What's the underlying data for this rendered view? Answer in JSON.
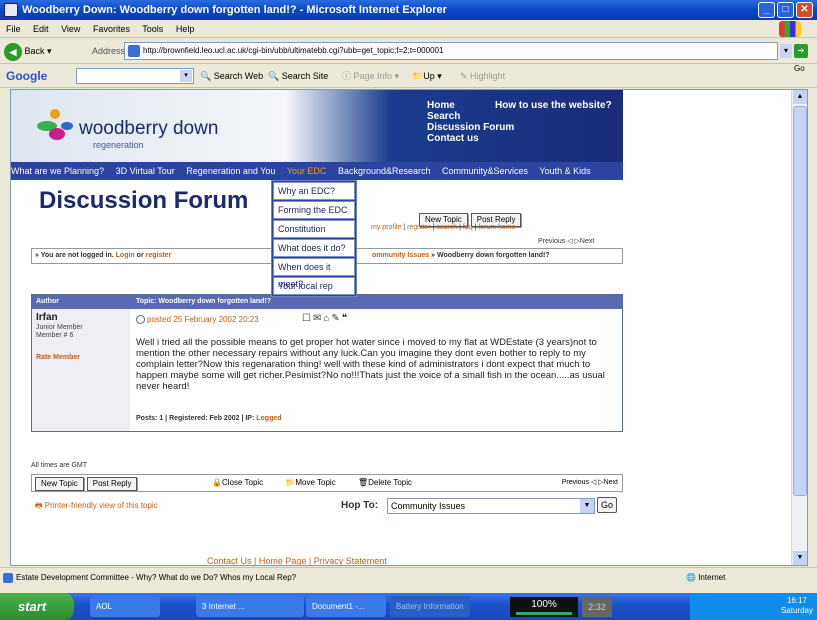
{
  "window": {
    "title": "Woodberry Down: Woodberry down forgotten land!? - Microsoft Internet Explorer"
  },
  "menu": [
    "File",
    "Edit",
    "View",
    "Favorites",
    "Tools",
    "Help"
  ],
  "toolbar": {
    "back_label": "Back",
    "address_label": "Address",
    "url": "http://brownfield.leo.ucl.ac.uk/cgi-bin/ubb/ultimatebb.cgi?ubb=get_topic;f=2;t=000001",
    "go_label": "Go"
  },
  "google_bar": {
    "logo": "Google",
    "search_web": "Search Web",
    "search_site": "Search Site",
    "page_info": "Page Info",
    "up": "Up",
    "highlight": "Highlight"
  },
  "site": {
    "logo_text": "woodberry down",
    "logo_sub": "regeneration",
    "header_nav": [
      "Home",
      "Search",
      "Discussion Forum",
      "Contact us"
    ],
    "how_to": "How to use the website?",
    "nav": [
      "What are we Planning?",
      "3D Virtual Tour",
      "Regeneration and You",
      "Your EDC",
      "Background&Research",
      "Community&Services",
      "Youth & Kids"
    ],
    "active_nav": "Your EDC",
    "dropdown": [
      "Why an EDC?",
      "Forming the EDC",
      "Constitution",
      "What does it do?",
      "When does it meet?",
      "Your local rep"
    ]
  },
  "forum": {
    "title": "Discussion Forum",
    "new_topic": "New Topic",
    "post_reply": "Post Reply",
    "top_links": [
      "my profile",
      "register",
      "search",
      "faq",
      "forum home"
    ],
    "prev": "Previous",
    "next": "Next",
    "not_logged_in": "» You are not logged in.",
    "login": "Login",
    "or": "or",
    "register": "register",
    "crumb_section": "ommunity Issues",
    "crumb_topic": "» Woodberry down forgotten land!?",
    "author_header": "Author",
    "topic_header": "Topic: Woodberry down forgotten land!?",
    "author": {
      "name": "Irfan",
      "rank": "Junior Member",
      "member_no": "Member # 6",
      "rate": "Rate Member"
    },
    "post": {
      "posted": "posted 25 February 2002 20:23",
      "body": "Well i tried all the possible means to get proper hot water since i moved to my flat at WDEstate (3 years)not to mention the other necessary repairs without any luck.Can you imagine they dont even bother to reply to my complain letter?Now this regenaration thing! well with these kind of administrators i dont expect that much to happen maybe some will get richer.Pesimist?No no!!!Thats just the voice of a small fish in the ocean.....as usual never heard!",
      "footer": "Posts: 1 | Registered: Feb 2002 | IP:",
      "ip": "Logged"
    },
    "times": "All times are GMT",
    "close_topic": "Close Topic",
    "move_topic": "Move Topic",
    "delete_topic": "Delete Topic",
    "printer": "Printer-friendly view of this topic",
    "hop_to": "Hop To:",
    "hop_value": "Community Issues",
    "go": "Go",
    "footer_links": "Contact Us | Home Page | Privacy Statement"
  },
  "statusbar": {
    "text": "Estate Development Committee - Why? What do we Do? Whos my Local Rep?",
    "zone": "Internet"
  },
  "taskbar": {
    "start": "start",
    "tasks": [
      "AOL",
      "3 Internet ...",
      "Document1 -..."
    ],
    "battery_info": "Battery Information",
    "battery_pct": "100%",
    "battery_time": "2:32",
    "clock_time": "16:17",
    "clock_day": "Saturday"
  }
}
